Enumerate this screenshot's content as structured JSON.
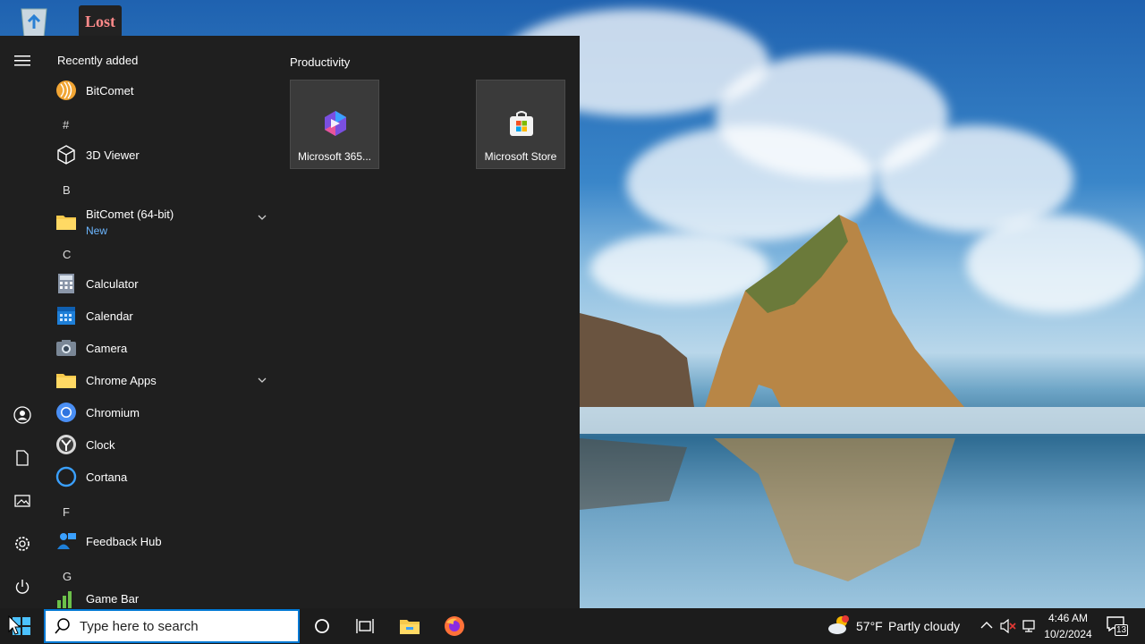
{
  "desktop": {
    "icons": [
      {
        "name": "recycle-bin",
        "label": ""
      },
      {
        "name": "lost-app",
        "label": "Lost"
      }
    ]
  },
  "start_menu": {
    "recently_added_title": "Recently added",
    "apps": [
      {
        "key": "bitcomet",
        "label": "BitComet",
        "icon": "bitcomet-icon"
      },
      {
        "letter": "#"
      },
      {
        "key": "3dviewer",
        "label": "3D Viewer",
        "icon": "cube-icon"
      },
      {
        "letter": "B"
      },
      {
        "key": "bitcomet64",
        "label": "BitComet (64-bit)",
        "sub": "New",
        "icon": "folder-icon",
        "expandable": true
      },
      {
        "letter": "C"
      },
      {
        "key": "calculator",
        "label": "Calculator",
        "icon": "calculator-icon"
      },
      {
        "key": "calendar",
        "label": "Calendar",
        "icon": "calendar-icon"
      },
      {
        "key": "camera",
        "label": "Camera",
        "icon": "camera-icon"
      },
      {
        "key": "chromeapps",
        "label": "Chrome Apps",
        "icon": "folder-icon",
        "expandable": true
      },
      {
        "key": "chromium",
        "label": "Chromium",
        "icon": "chromium-icon"
      },
      {
        "key": "clock",
        "label": "Clock",
        "icon": "clock-icon"
      },
      {
        "key": "cortana",
        "label": "Cortana",
        "icon": "cortana-icon"
      },
      {
        "letter": "F"
      },
      {
        "key": "feedbackhub",
        "label": "Feedback Hub",
        "icon": "feedback-icon"
      },
      {
        "letter": "G"
      },
      {
        "key": "gamebar",
        "label": "Game Bar",
        "icon": "gamebar-icon"
      }
    ],
    "tiles_title": "Productivity",
    "tiles": [
      {
        "key": "m365",
        "label": "Microsoft 365...",
        "icon": "microsoft-365-icon"
      },
      {
        "key": "store",
        "label": "Microsoft Store",
        "icon": "microsoft-store-icon"
      }
    ]
  },
  "taskbar": {
    "search_placeholder": "Type here to search",
    "weather_temp": "57°F",
    "weather_desc": "Partly cloudy",
    "time": "4:46 AM",
    "date": "10/2/2024",
    "notification_count": "13"
  },
  "colors": {
    "start_bg": "#1f1f1f",
    "taskbar_bg": "#1c1c1c",
    "accent": "#0078d4",
    "new_badge": "#6cb6ff"
  }
}
